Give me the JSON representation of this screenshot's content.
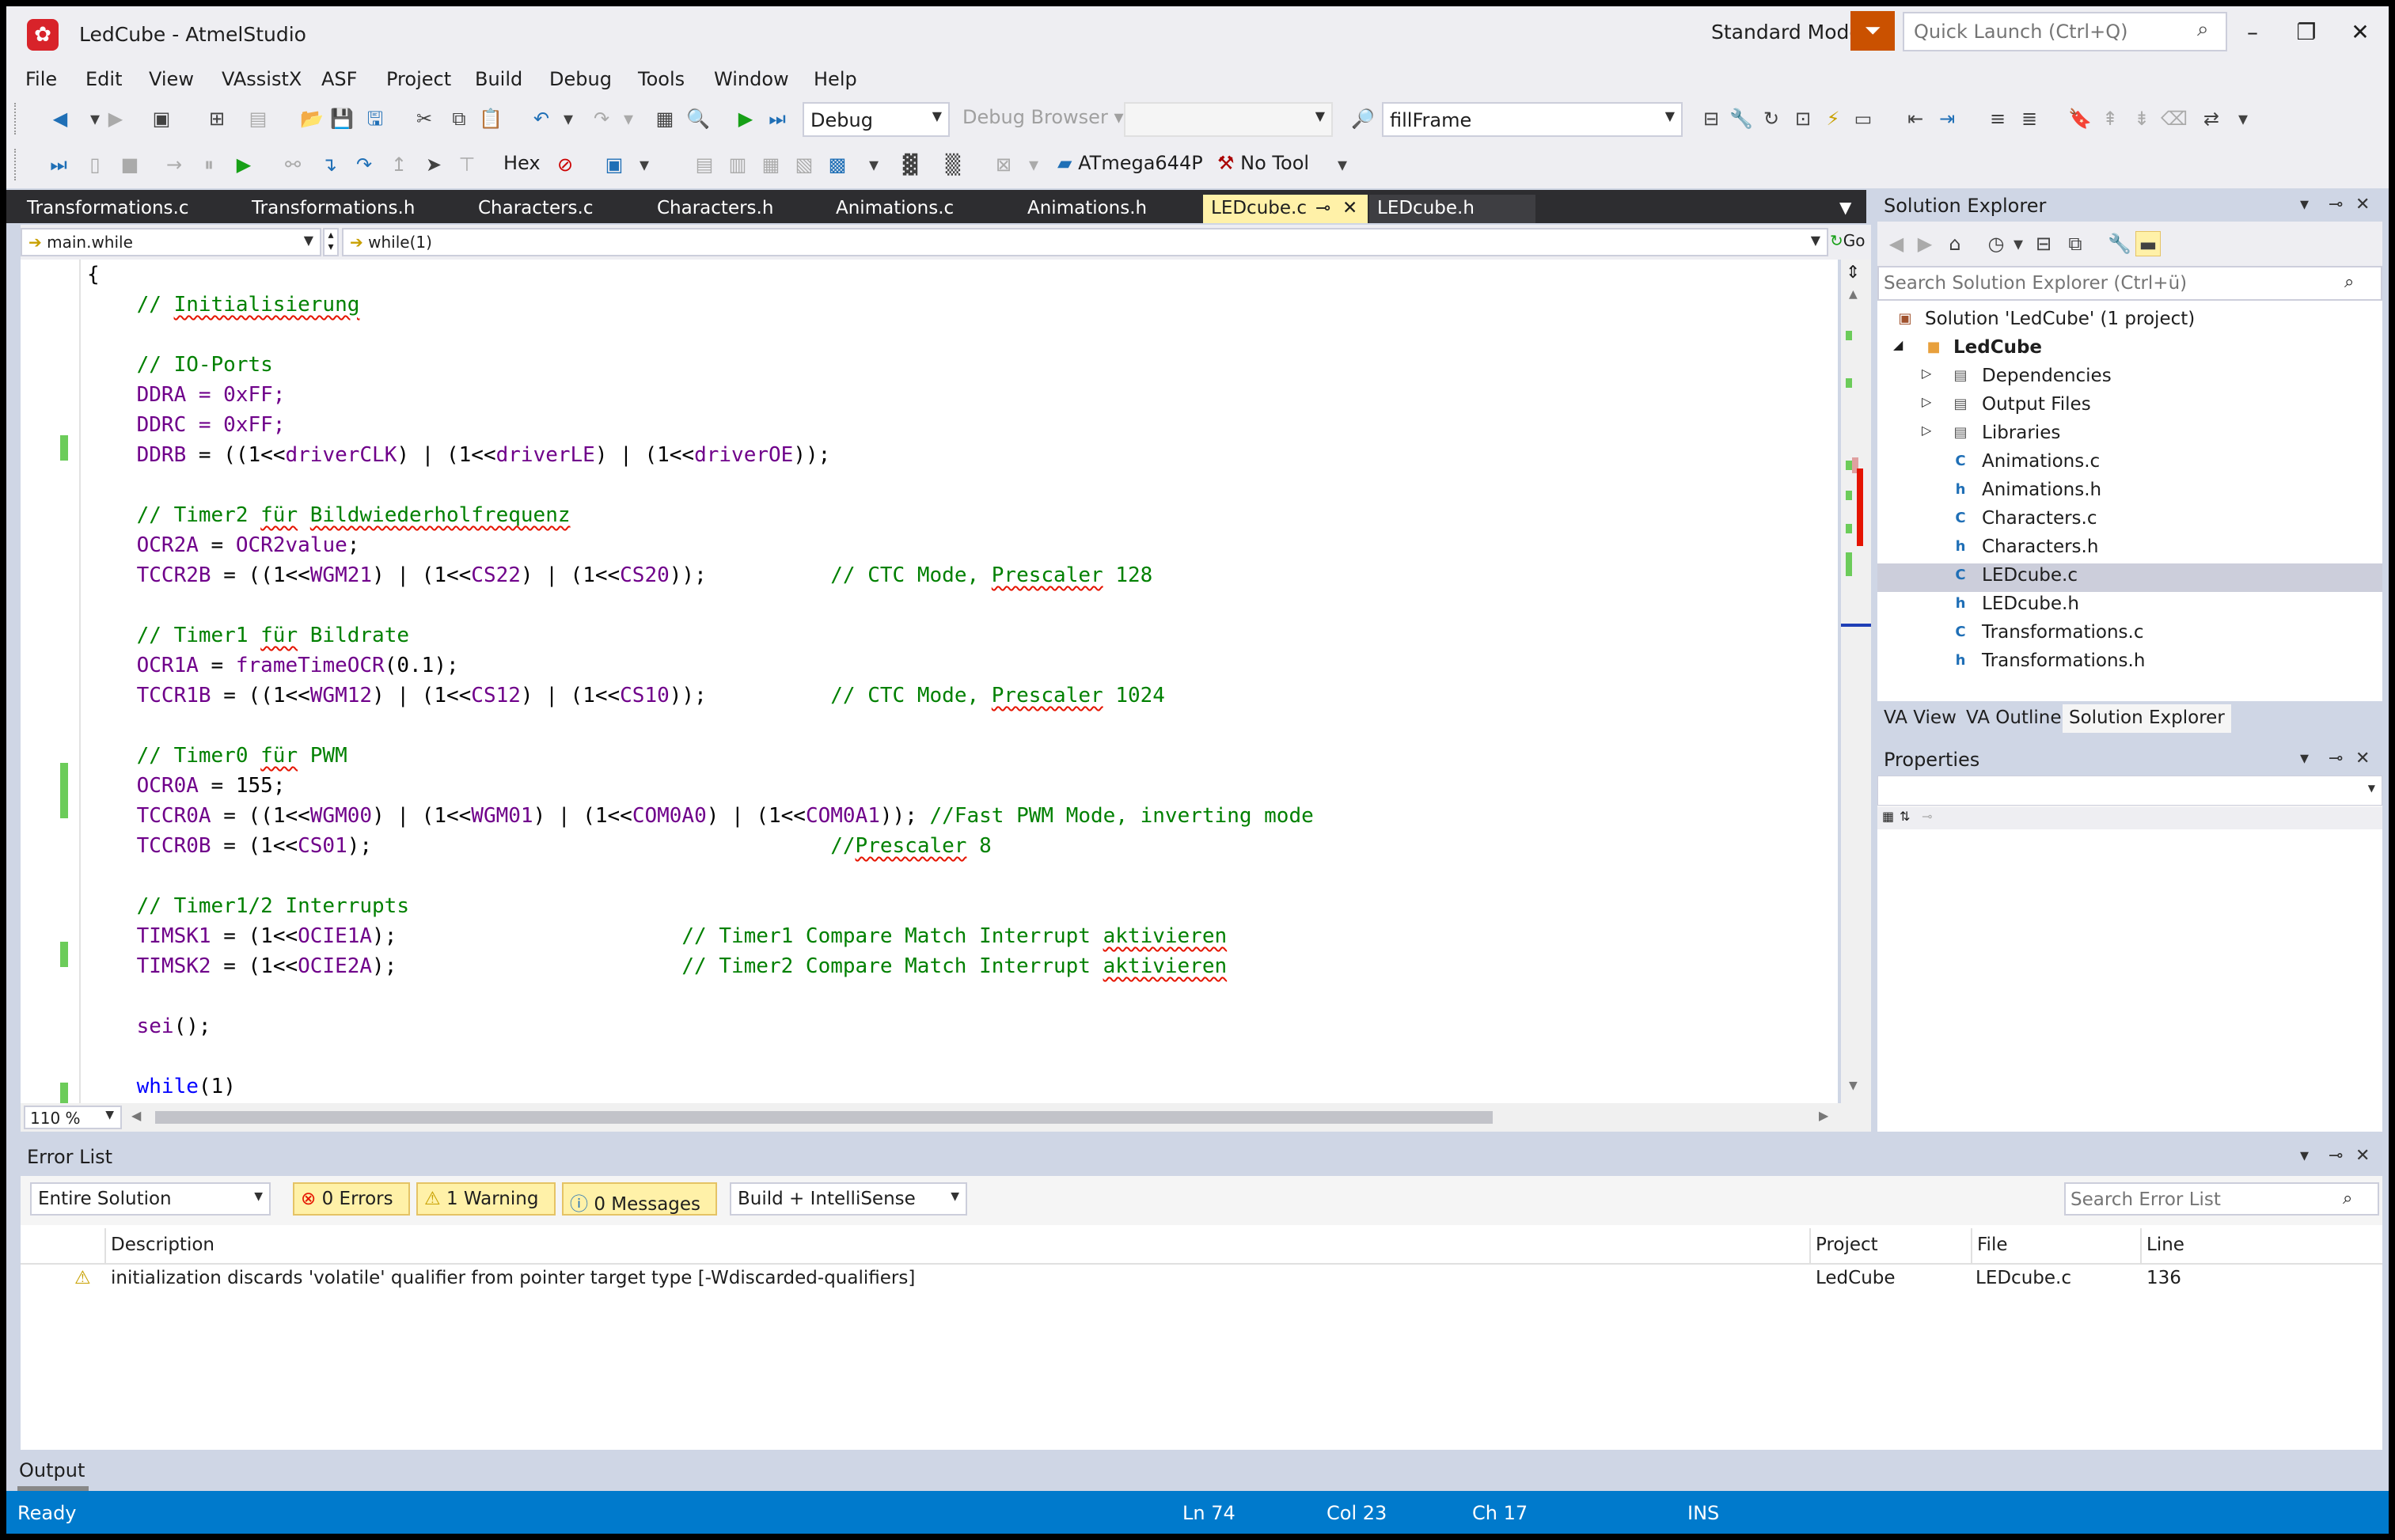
{
  "window": {
    "title": "LedCube - AtmelStudio",
    "mode": "Standard Mode",
    "quick_launch_placeholder": "Quick Launch (Ctrl+Q)"
  },
  "menu": [
    "File",
    "Edit",
    "View",
    "VAssistX",
    "ASF",
    "Project",
    "Build",
    "Debug",
    "Tools",
    "Window",
    "Help"
  ],
  "toolbar": {
    "config": "Debug",
    "debug_browser": "Debug Browser",
    "find_box": "fillFrame",
    "hex_label": "Hex",
    "device": "ATmega644P",
    "tool": "No Tool"
  },
  "tabs": [
    {
      "label": "Transformations.c"
    },
    {
      "label": "Transformations.h"
    },
    {
      "label": "Characters.c"
    },
    {
      "label": "Characters.h"
    },
    {
      "label": "Animations.c"
    },
    {
      "label": "Animations.h"
    },
    {
      "label": "LEDcube.c"
    },
    {
      "label": "LEDcube.h"
    }
  ],
  "nav": {
    "scope": "main.while",
    "member": "while(1)",
    "go": "Go"
  },
  "code": [
    "{",
    "    // Initialisierung",
    "",
    "    // IO-Ports",
    "    DDRA = 0xFF;",
    "    DDRC = 0xFF;",
    "    DDRB = ((1<<driverCLK) | (1<<driverLE) | (1<<driverOE));",
    "",
    "    // Timer2 für Bildwiederholfrequenz",
    "    OCR2A = OCR2value;",
    "    TCCR2B = ((1<<WGM21) | (1<<CS22) | (1<<CS20));          // CTC Mode, Prescaler 128",
    "",
    "    // Timer1 für Bildrate",
    "    OCR1A = frameTimeOCR(0.1);",
    "    TCCR1B = ((1<<WGM12) | (1<<CS12) | (1<<CS10));          // CTC Mode, Prescaler 1024",
    "",
    "    // Timer0 für PWM",
    "    OCR0A = 155;",
    "    TCCR0A = ((1<<WGM00) | (1<<WGM01) | (1<<COM0A0) | (1<<COM0A1)); //Fast PWM Mode, inverting mode",
    "    TCCR0B = (1<<CS01);                                     //Prescaler 8",
    "",
    "    // Timer1/2 Interrupts",
    "    TIMSK1 = (1<<OCIE1A);                       // Timer1 Compare Match Interrupt aktivieren",
    "    TIMSK2 = (1<<OCIE2A);                       // Timer2 Compare Match Interrupt aktivieren",
    "",
    "    sei();",
    "",
    "    while(1)",
    "    {"
  ],
  "zoom": "110 %",
  "solution_explorer": {
    "title": "Solution Explorer",
    "search_placeholder": "Search Solution Explorer (Ctrl+ü)",
    "solution": "Solution 'LedCube' (1 project)",
    "project": "LedCube",
    "folders": [
      "Dependencies",
      "Output Files",
      "Libraries"
    ],
    "files": [
      {
        "name": "Animations.c",
        "type": "c"
      },
      {
        "name": "Animations.h",
        "type": "h"
      },
      {
        "name": "Characters.c",
        "type": "c"
      },
      {
        "name": "Characters.h",
        "type": "h"
      },
      {
        "name": "LEDcube.c",
        "type": "c"
      },
      {
        "name": "LEDcube.h",
        "type": "h"
      },
      {
        "name": "Transformations.c",
        "type": "c"
      },
      {
        "name": "Transformations.h",
        "type": "h"
      }
    ],
    "bottom_tabs": [
      "VA View",
      "VA Outline",
      "Solution Explorer"
    ]
  },
  "properties": {
    "title": "Properties"
  },
  "error_list": {
    "title": "Error List",
    "scope": "Entire Solution",
    "errors": "0 Errors",
    "warnings": "1 Warning",
    "messages": "0 Messages",
    "source": "Build + IntelliSense",
    "search_placeholder": "Search Error List",
    "columns": [
      "Description",
      "Project",
      "File",
      "Line"
    ],
    "rows": [
      {
        "description": "initialization discards 'volatile' qualifier from pointer target type [-Wdiscarded-qualifiers]",
        "project": "LedCube",
        "file": "LEDcube.c",
        "line": "136"
      }
    ]
  },
  "output": {
    "label": "Output"
  },
  "status": {
    "state": "Ready",
    "ln": "Ln 74",
    "col": "Col 23",
    "ch": "Ch 17",
    "ins": "INS"
  }
}
